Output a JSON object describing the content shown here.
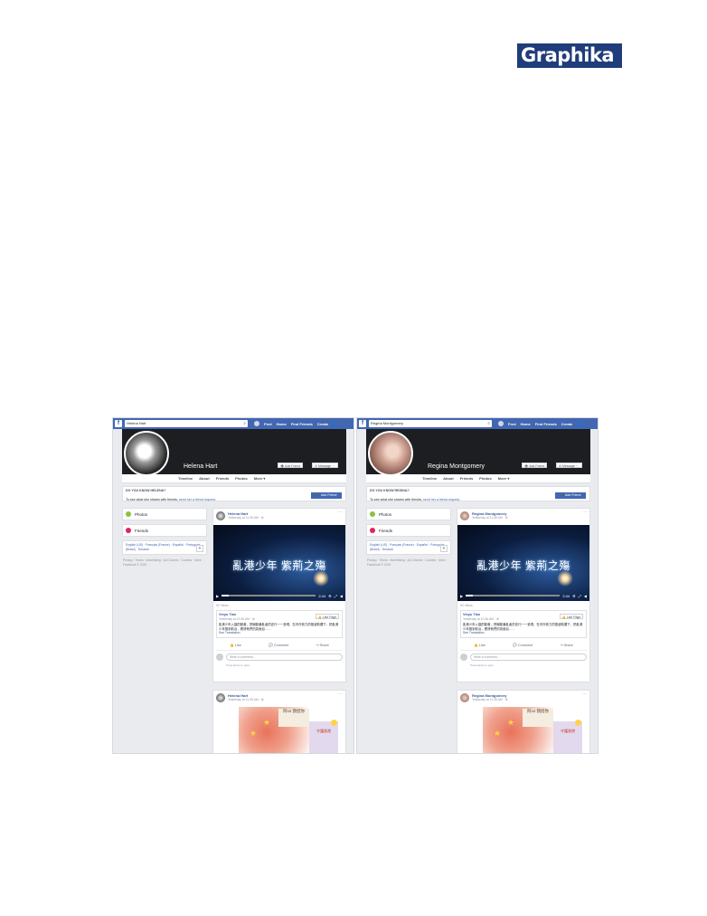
{
  "logo": {
    "text": "Graphika"
  },
  "panels": [
    {
      "search_value": "Helena Hart",
      "nav": [
        "Fred",
        "Home",
        "Find Friends",
        "Create"
      ],
      "profile_name": "Helena Hart",
      "add_friend": "Add Friend",
      "message": "Message",
      "tabs": [
        "Timeline",
        "About",
        "Friends",
        "Photos",
        "More ▾"
      ],
      "know_heading": "DO YOU KNOW HELENA?",
      "know_text": "To see what she shares with friends,",
      "know_link": "send her a friend request.",
      "know_button": "Add Friend",
      "sidebar": [
        "Photos",
        "Friends"
      ],
      "languages": "English (US) · Français (France) · Español · Português (Brasil) · Deutsch",
      "footer": "Privacy · Terms · Advertising · Ad Choices · Cookies · More · Facebook © 2019",
      "post1": {
        "author": "Helena Hart",
        "time": "Yesterday at 11:35 AM · ⊕",
        "video_title": "亂港少年 紫荊之殤",
        "video_time": "2:44",
        "views": "92 Views",
        "page_name": "Vinyu Tian",
        "page_time": "Yesterday at 10:36 AM · ⊕",
        "like_page": "Like Page",
        "text": "亂港少年入園的動畫，把煽動暴亂者的言行一一呈現，在內外勢力的推波助瀾下，把亂港少年推到前台，看清他們的真面目……",
        "see_translation": "See Translation",
        "actions": [
          "Like",
          "Comment",
          "Share"
        ],
        "comment_placeholder": "Write a comment...",
        "comment_hint": "Press Enter to post."
      },
      "post2": {
        "author": "Helena Hart",
        "time": "Yesterday at 11:35 AM · ⊕",
        "note": "阿sir 我挺你",
        "sign": "守護香港"
      }
    },
    {
      "search_value": "Regina Montgomery",
      "nav": [
        "Fred",
        "Home",
        "Find Friends",
        "Create"
      ],
      "profile_name": "Regina Montgomery",
      "add_friend": "Add Friend",
      "message": "Message",
      "tabs": [
        "Timeline",
        "About",
        "Friends",
        "Photos",
        "More ▾"
      ],
      "know_heading": "DO YOU KNOW REGINA?",
      "know_text": "To see what she shares with friends,",
      "know_link": "send her a friend request.",
      "know_button": "Add Friend",
      "sidebar": [
        "Photos",
        "Friends"
      ],
      "languages": "English (US) · Français (France) · Español · Português (Brasil) · Deutsch",
      "footer": "Privacy · Terms · Advertising · Ad Choices · Cookies · More · Facebook © 2019",
      "post1": {
        "author": "Regina Montgomery",
        "time": "Yesterday at 11:36 AM · ⊕",
        "video_title": "亂港少年 紫荊之殤",
        "video_time": "2:44",
        "views": "92 Views",
        "page_name": "Vinyu Tian",
        "page_time": "Yesterday at 10:36 AM · ⊕",
        "like_page": "Like Page",
        "text": "亂港少年入園的動畫，把煽動暴亂者的言行一一呈現，在內外勢力的推波助瀾下，把亂港少年推到前台，看清他們的真面目……",
        "see_translation": "See Translation",
        "actions": [
          "Like",
          "Comment",
          "Share"
        ],
        "comment_placeholder": "Write a comment...",
        "comment_hint": "Press Enter to post."
      },
      "post2": {
        "author": "Regina Montgomery",
        "time": "Yesterday at 11:36 AM · ⊕",
        "note": "阿sir 我挺你",
        "sign": "守護香港"
      }
    }
  ],
  "colors": {
    "facebook_blue": "#4267b2",
    "background": "#e9ebee",
    "link": "#385898",
    "logo_bg": "#1f3d7a"
  }
}
